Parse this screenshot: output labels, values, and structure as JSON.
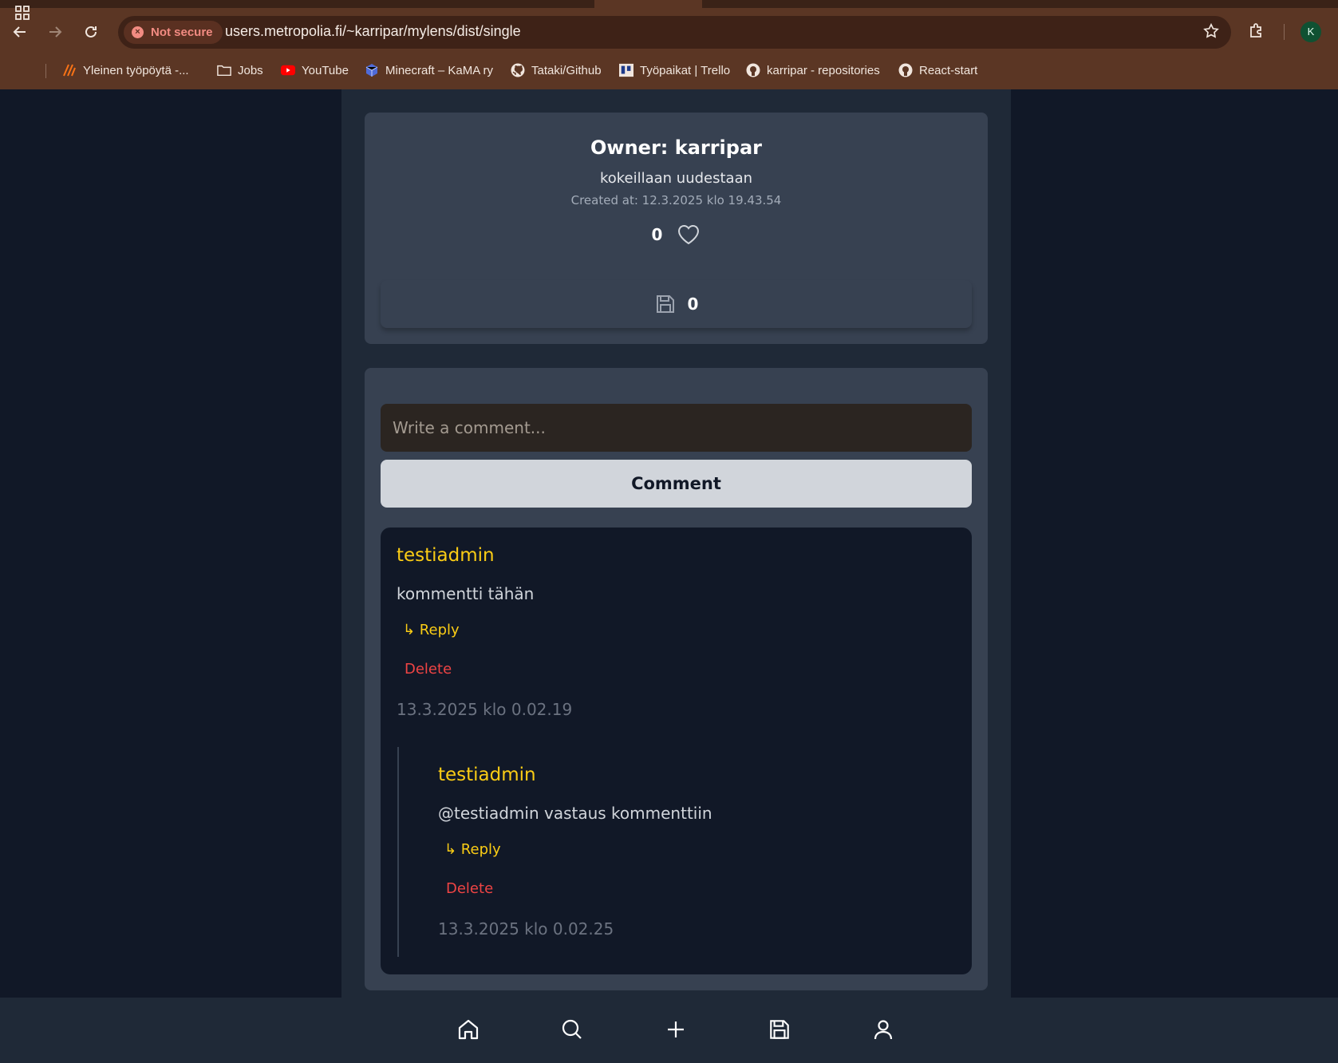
{
  "browser": {
    "security_label": "Not secure",
    "url": "users.metropolia.fi/~karripar/mylens/dist/single",
    "profile_initial": "K",
    "bookmarks": [
      {
        "label": "Yleinen työpöytä -...",
        "icon": "app-icon"
      },
      {
        "label": "Jobs",
        "icon": "folder-icon"
      },
      {
        "label": "YouTube",
        "icon": "youtube-icon"
      },
      {
        "label": "Minecraft – KaMA ry",
        "icon": "site-icon"
      },
      {
        "label": "Tataki/Github",
        "icon": "github-icon"
      },
      {
        "label": "Työpaikat | Trello",
        "icon": "trello-icon"
      },
      {
        "label": "karripar - repositories",
        "icon": "github-icon"
      },
      {
        "label": "React-start",
        "icon": "github-icon"
      }
    ]
  },
  "post": {
    "owner": "Owner: karripar",
    "description": "kokeillaan uudestaan",
    "created_at": "Created at: 12.3.2025 klo 19.43.54",
    "likes": "0",
    "saves": "0"
  },
  "comment_form": {
    "placeholder": "Write a comment...",
    "button": "Comment"
  },
  "comments": [
    {
      "author": "testiadmin",
      "text": "kommentti tähän",
      "reply_label": "↳ Reply",
      "delete_label": "Delete",
      "date": "13.3.2025 klo 0.02.19"
    },
    {
      "author": "testiadmin",
      "text": "@testiadmin vastaus kommenttiin",
      "reply_label": "↳ Reply",
      "delete_label": "Delete",
      "date": "13.3.2025 klo 0.02.25"
    }
  ],
  "colors": {
    "page_bg": "#111827",
    "column_bg": "#1f2937",
    "card_bg": "#374151",
    "author": "#facc15",
    "delete": "#ef4444"
  },
  "bottom_nav": [
    "home-icon",
    "search-icon",
    "plus-icon",
    "save-icon",
    "user-icon"
  ]
}
